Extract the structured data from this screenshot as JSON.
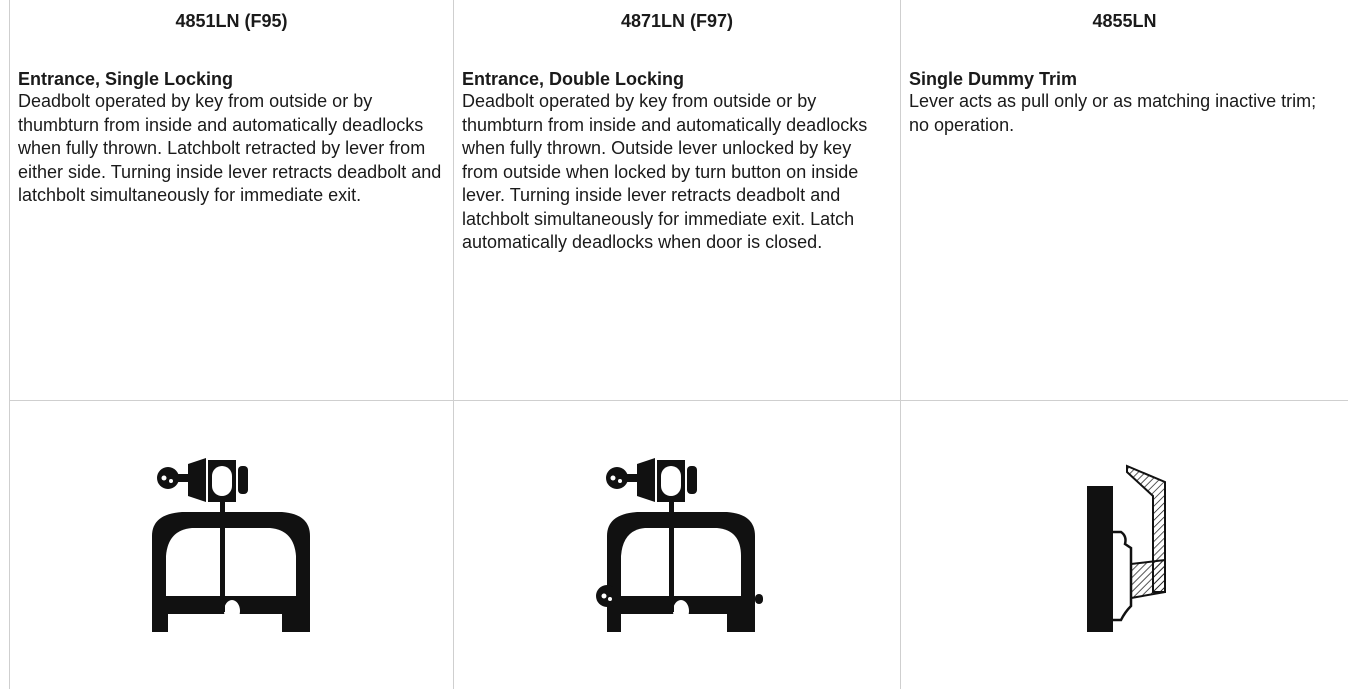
{
  "columns": [
    {
      "model": "4851LN (F95)",
      "function": "Entrance, Single Locking",
      "description": "Deadbolt operated by key from outside or by thumbturn from inside and automatically deadlocks when fully thrown. Latchbolt retracted by lever from either side. Turning inside lever retracts deadbolt and latchbolt simultaneously for immediate exit.",
      "figure_icon": "entrance-single-locking-lever-icon"
    },
    {
      "model": "4871LN (F97)",
      "function": "Entrance, Double Locking",
      "description": "Deadbolt operated by key from outside or by thumbturn from inside and automatically deadlocks when fully thrown. Outside lever unlocked by key from outside when locked by turn button on inside lever. Turning inside lever retracts deadbolt and latchbolt simultaneously for immediate exit. Latch automatically deadlocks when door is closed.",
      "figure_icon": "entrance-double-locking-lever-icon"
    },
    {
      "model": "4855LN",
      "function": "Single Dummy Trim",
      "description": "Lever acts as pull only or as matching inactive trim; no operation.",
      "figure_icon": "single-dummy-trim-icon"
    }
  ],
  "colors": {
    "ink": "#1a1a1a",
    "rule": "#cfcfcf",
    "background": "#ffffff"
  }
}
